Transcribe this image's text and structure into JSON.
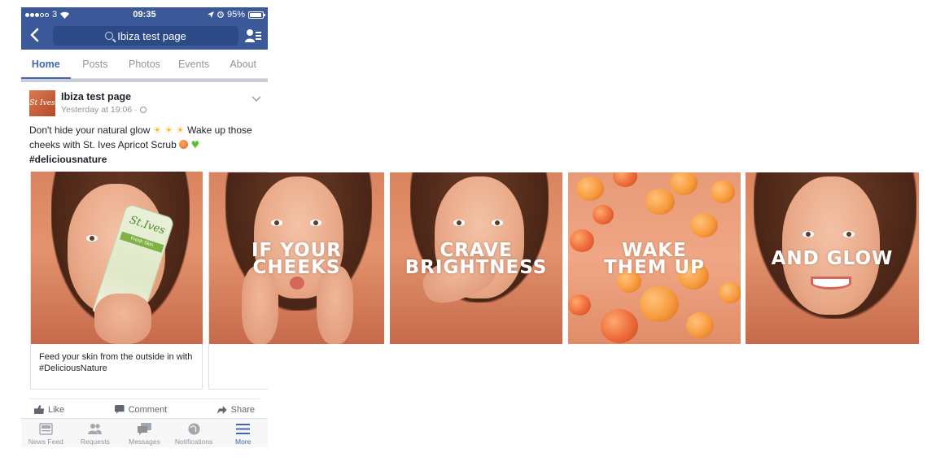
{
  "status_bar": {
    "carrier": "3",
    "time": "09:35",
    "battery": "95%"
  },
  "nav": {
    "search_text": "Ibiza test page"
  },
  "tabs": [
    {
      "label": "Home",
      "active": true
    },
    {
      "label": "Posts",
      "active": false
    },
    {
      "label": "Photos",
      "active": false
    },
    {
      "label": "Events",
      "active": false
    },
    {
      "label": "About",
      "active": false
    }
  ],
  "post": {
    "avatar_text": "St Ives",
    "page_name": "Ibiza test page",
    "timestamp": "Yesterday at 19:06",
    "separator": "·",
    "text_line1": "Don't hide your natural glow",
    "text_line1b": "Wake up those",
    "text_line2": "cheeks with St. Ives Apricot Scrub",
    "hashtag": "#deliciousnature",
    "card_caption": "Feed your skin from the outside in with #DeliciousNature",
    "actions": {
      "like": "Like",
      "comment": "Comment",
      "share": "Share"
    }
  },
  "bottom_tabs": [
    {
      "label": "News Feed",
      "icon": "news-feed-icon",
      "active": false
    },
    {
      "label": "Requests",
      "icon": "requests-icon",
      "active": false
    },
    {
      "label": "Messages",
      "icon": "messages-icon",
      "active": false
    },
    {
      "label": "Notifications",
      "icon": "notifications-icon",
      "active": false
    },
    {
      "label": "More",
      "icon": "more-icon",
      "active": true
    }
  ],
  "slides": [
    {
      "overlay_line1": "",
      "overlay_line2": "",
      "product_label": "St.Ives",
      "product_band": "Fresh Skin"
    },
    {
      "overlay_line1": "IF YOUR",
      "overlay_line2": "CHEEKS"
    },
    {
      "overlay_line1": "CRAVE",
      "overlay_line2": "BRIGHTNESS"
    },
    {
      "overlay_line1": "WAKE",
      "overlay_line2": "THEM UP"
    },
    {
      "overlay_line1": "AND GLOW",
      "overlay_line2": ""
    }
  ],
  "colors": {
    "brand": "#3b5998",
    "accent": "#4267b2",
    "muted": "#90949c"
  }
}
